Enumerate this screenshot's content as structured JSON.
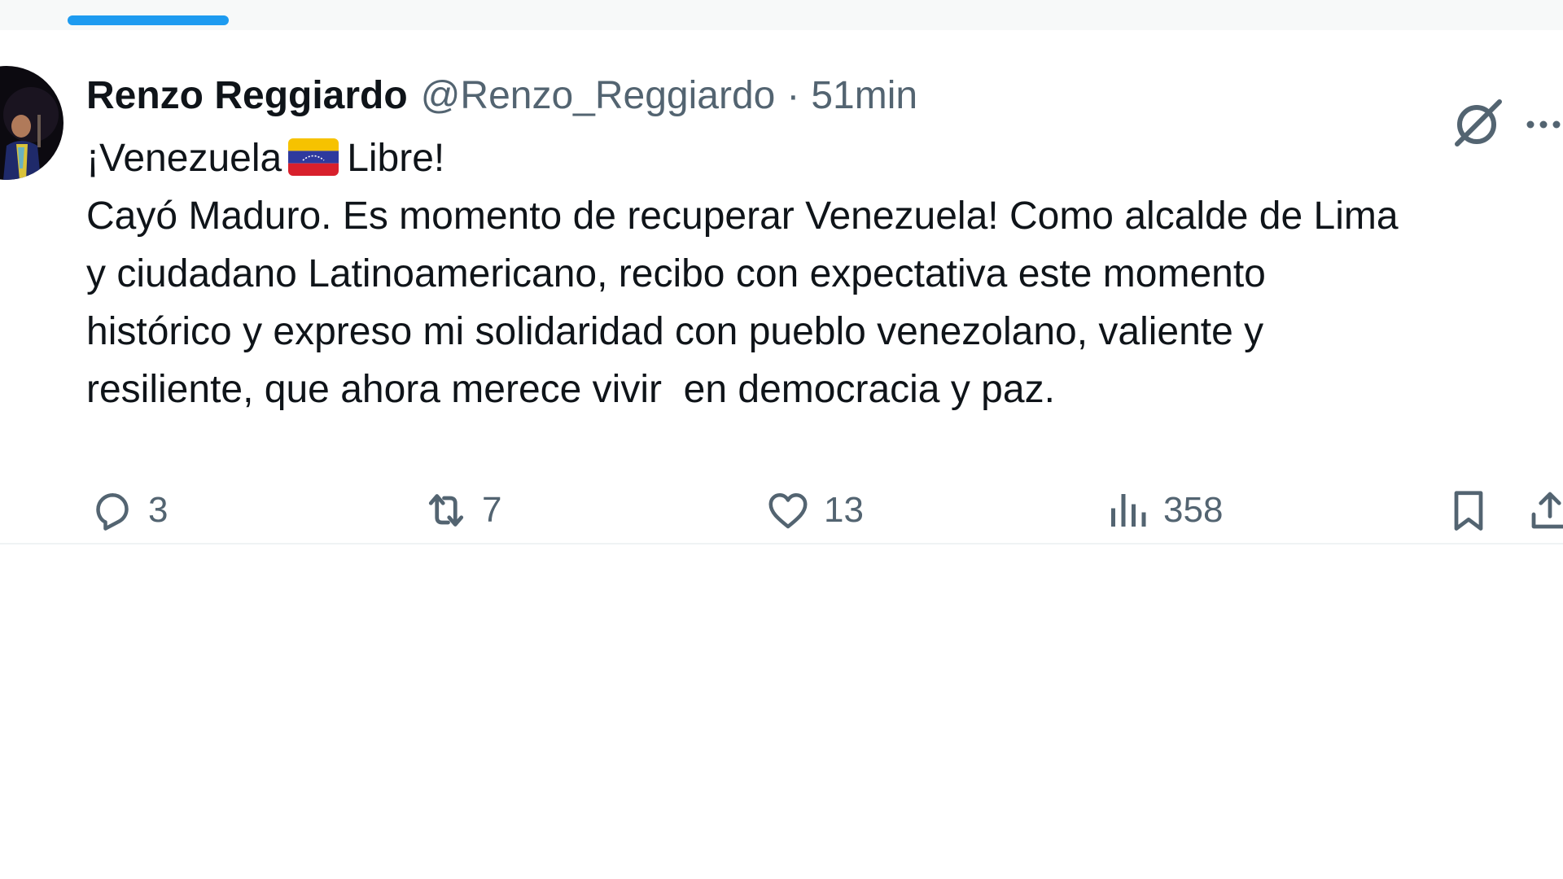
{
  "post": {
    "author": {
      "display_name": "Renzo Reggiardo",
      "handle": "@Renzo_Reggiardo"
    },
    "separator": "·",
    "timestamp": "51min",
    "text_lines": [
      "¡Venezuela",
      "Libre!",
      "Cayó Maduro. Es momento de recuperar Venezuela! Como alcalde de Lima",
      "y ciudadano Latinoamericano, recibo con expectativa este momento",
      "histórico y expreso mi solidaridad con pueblo venezolano, valiente y",
      "resiliente, que ahora merece vivir  en democracia y paz."
    ],
    "actions": {
      "reply_count": "3",
      "repost_count": "7",
      "like_count": "13",
      "views_count": "358"
    }
  },
  "icons": {
    "reply": "speech-bubble",
    "repost": "repost-arrows",
    "like": "heart",
    "views": "bar-chart",
    "bookmark": "bookmark",
    "share": "share-upload",
    "grok": "grok-slash-circle",
    "more": "ellipsis",
    "flag": "venezuela-flag"
  },
  "colors": {
    "accent": "#1d9bf0",
    "text_primary": "#0f1419",
    "text_secondary": "#536471",
    "divider": "#eff3f4"
  }
}
